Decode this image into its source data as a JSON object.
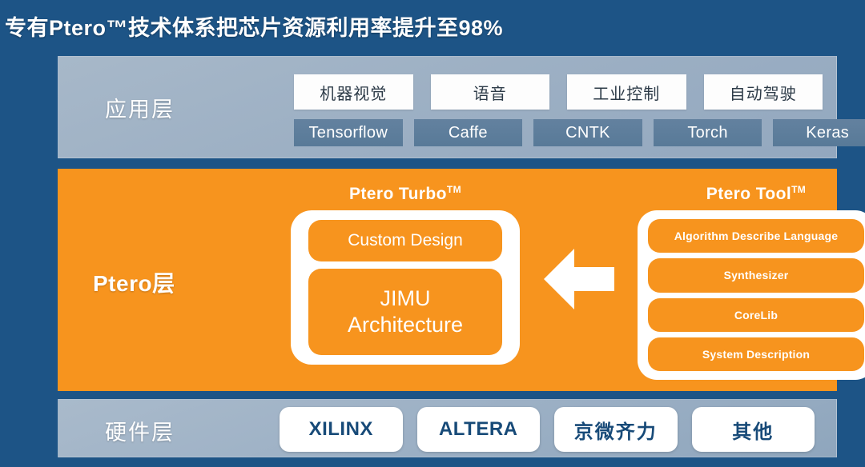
{
  "title": "专有Ptero™技术体系把芯片资源利用率提升至98%",
  "colors": {
    "background_blue": "#1d5486",
    "panel_gray_blue": "#9db0c4",
    "ptero_orange": "#f7941e",
    "framework_blue": "#5e7d9c",
    "hardware_text_navy": "#174a78",
    "white": "#ffffff"
  },
  "application_layer": {
    "label": "应用层",
    "applications": [
      {
        "label": "机器视觉"
      },
      {
        "label": "语音"
      },
      {
        "label": "工业控制"
      },
      {
        "label": "自动驾驶"
      }
    ],
    "frameworks": [
      {
        "label": "Tensorflow"
      },
      {
        "label": "Caffe"
      },
      {
        "label": "CNTK"
      },
      {
        "label": "Torch"
      },
      {
        "label": "Keras"
      }
    ]
  },
  "ptero_layer": {
    "label": "Ptero层",
    "turbo": {
      "heading": "Ptero Turbo",
      "trademark": "TM",
      "items": [
        {
          "label": "Custom Design"
        },
        {
          "label": "JIMU\nArchitecture"
        }
      ]
    },
    "arrow": {
      "direction": "left",
      "icon": "arrow-left-icon"
    },
    "tool": {
      "heading": "Ptero Tool",
      "trademark": "TM",
      "items": [
        {
          "label": "Algorithm Describe Language"
        },
        {
          "label": "Synthesizer"
        },
        {
          "label": "CoreLib"
        },
        {
          "label": "System Description"
        }
      ]
    }
  },
  "hardware_layer": {
    "label": "硬件层",
    "vendors": [
      {
        "label": "XILINX"
      },
      {
        "label": "ALTERA"
      },
      {
        "label": "京微齐力"
      },
      {
        "label": "其他"
      }
    ]
  }
}
